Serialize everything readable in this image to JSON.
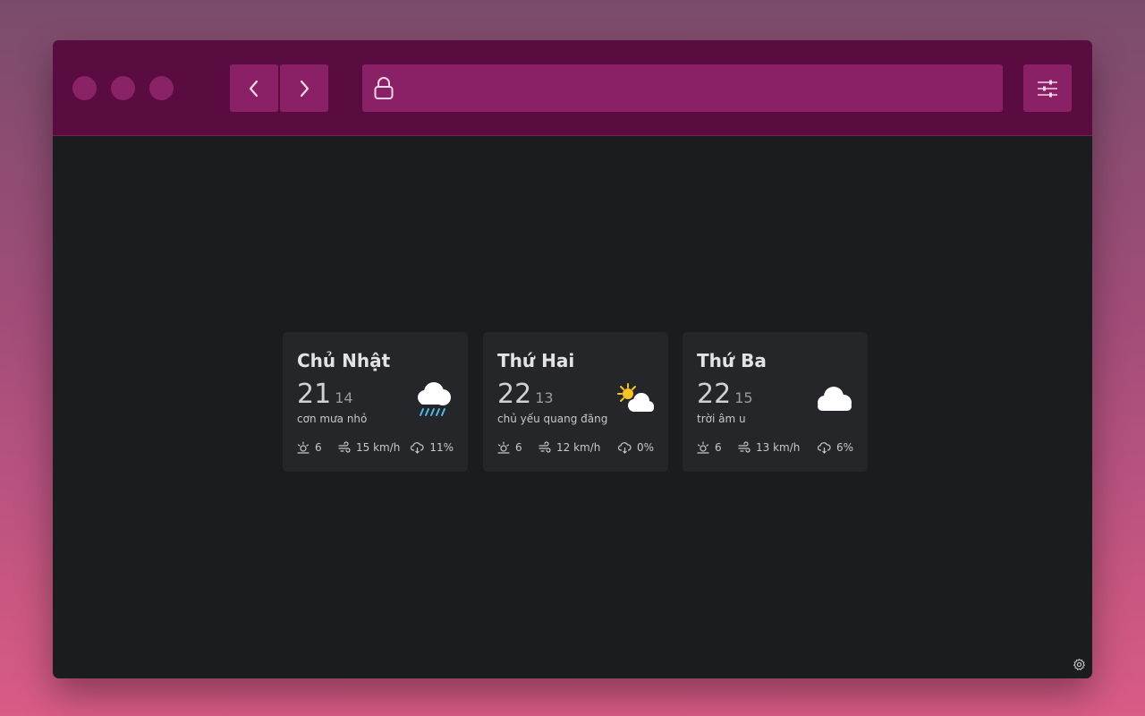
{
  "browser": {
    "window_controls": [
      "close",
      "minimize",
      "maximize"
    ],
    "back_icon": "chevron-left-icon",
    "forward_icon": "chevron-right-icon",
    "url_icon": "lock-icon",
    "url_value": "",
    "settings_icon": "sliders-icon"
  },
  "forecast": [
    {
      "day": "Chủ Nhật",
      "high": "21",
      "low": "14",
      "condition": "cơn mưa nhỏ",
      "icon": "rain-cloud-icon",
      "uv": "6",
      "wind": "15 km/h",
      "precip": "11%"
    },
    {
      "day": "Thứ Hai",
      "high": "22",
      "low": "13",
      "condition": "chủ yếu quang đãng",
      "icon": "sun-behind-cloud-icon",
      "uv": "6",
      "wind": "12 km/h",
      "precip": "0%"
    },
    {
      "day": "Thứ Ba",
      "high": "22",
      "low": "15",
      "condition": "trời âm u",
      "icon": "cloud-icon",
      "uv": "6",
      "wind": "13 km/h",
      "precip": "6%"
    }
  ],
  "footer": {
    "settings_icon": "gear-icon"
  },
  "colors": {
    "titlebar": "#5a0c41",
    "button": "#8a2066",
    "content_bg": "#1b1c1f",
    "card_bg": "#25262a",
    "rain_accent": "#4fb8e8",
    "sun_accent": "#f6c325"
  }
}
